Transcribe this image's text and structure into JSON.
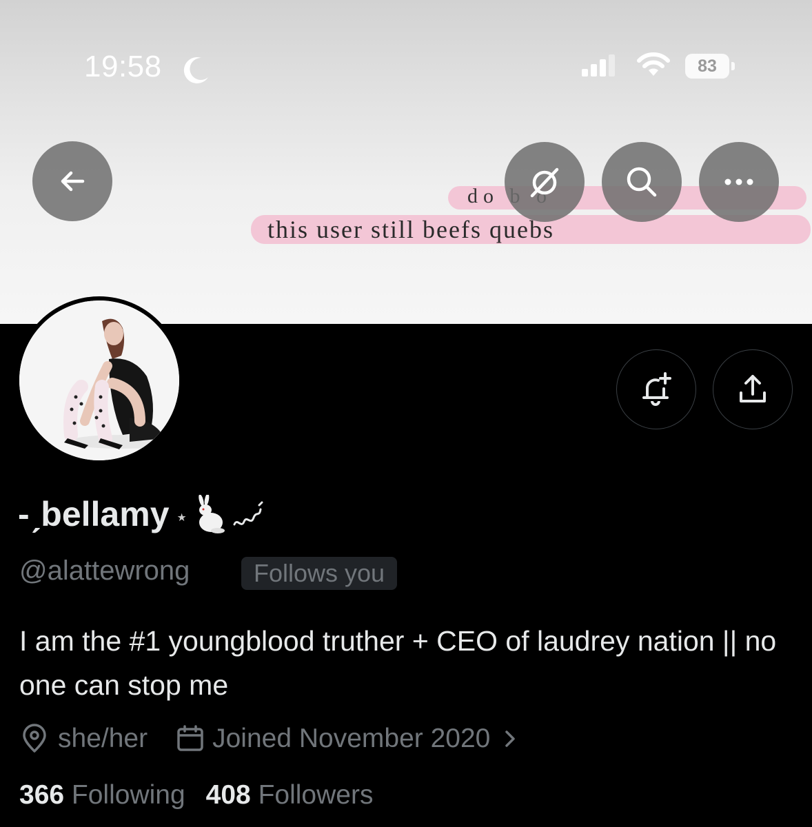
{
  "status_bar": {
    "time": "19:58",
    "battery": "83",
    "icons": [
      "moon-icon",
      "signal-icon",
      "wifi-icon",
      "battery-icon"
    ]
  },
  "header": {
    "buttons": [
      "back-icon",
      "grok-icon",
      "search-icon",
      "more-icon"
    ],
    "more_label": "•••"
  },
  "banner": {
    "line1": "do      b      o",
    "line2": "this user still beefs quebs"
  },
  "profile": {
    "display_name": "-ˏbellamy",
    "name_star": "⋆",
    "handle": "@alattewrong",
    "follows_you": "Follows you",
    "bio": "I am the #1 youngblood truther + CEO of laudrey nation || no one can stop me",
    "location": "she/her",
    "joined": "Joined November 2020",
    "following_count": "366",
    "following_label": "Following",
    "followers_count": "408",
    "followers_label": "Followers"
  },
  "actions": [
    "notify-bell-icon",
    "share-icon"
  ],
  "colors": {
    "background": "#000000",
    "text_primary": "#e7e9ea",
    "text_secondary": "#71767b",
    "badge_bg": "#202327",
    "banner_bubble": "#f3c6d6"
  }
}
